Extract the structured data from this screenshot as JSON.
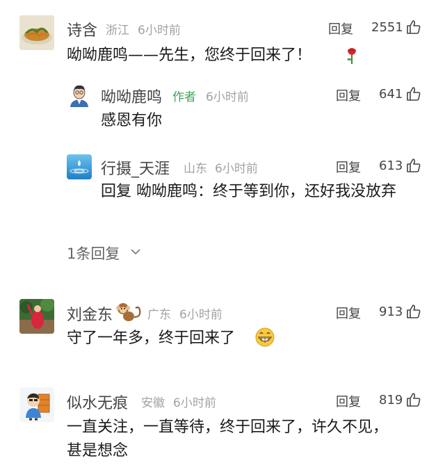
{
  "comments": [
    {
      "author": "诗含",
      "location": "浙江",
      "time": "6小时前",
      "reply_label": "回复",
      "likes": "2551",
      "text": "呦呦鹿鸣——先生，您终于回来了！",
      "emoji": "rose-icon",
      "replies": [
        {
          "author": "呦呦鹿鸣",
          "author_tag": "作者",
          "time": "6小时前",
          "reply_label": "回复",
          "likes": "641",
          "text": "感恩有你"
        },
        {
          "author": "行摄_天涯",
          "location": "山东",
          "time": "6小时前",
          "reply_label": "回复",
          "likes": "613",
          "text": "回复 呦呦鹿鸣：终于等到你，还好我没放弃"
        }
      ],
      "more_replies": "1条回复"
    },
    {
      "author": "刘金东",
      "badge": "monkey-icon",
      "location": "广东",
      "time": "6小时前",
      "reply_label": "回复",
      "likes": "913",
      "text": "守了一年多，终于回来了",
      "emoji": "grin-icon"
    },
    {
      "author": "似水无痕",
      "location": "安徽",
      "time": "6小时前",
      "reply_label": "回复",
      "likes": "819",
      "text": "一直关注，一直等待，终于回来了，许久不见，甚是想念"
    }
  ],
  "colors": {
    "author_tag": "#3aa757",
    "meta": "#a2a2a2",
    "text": "#1a1a1a"
  }
}
